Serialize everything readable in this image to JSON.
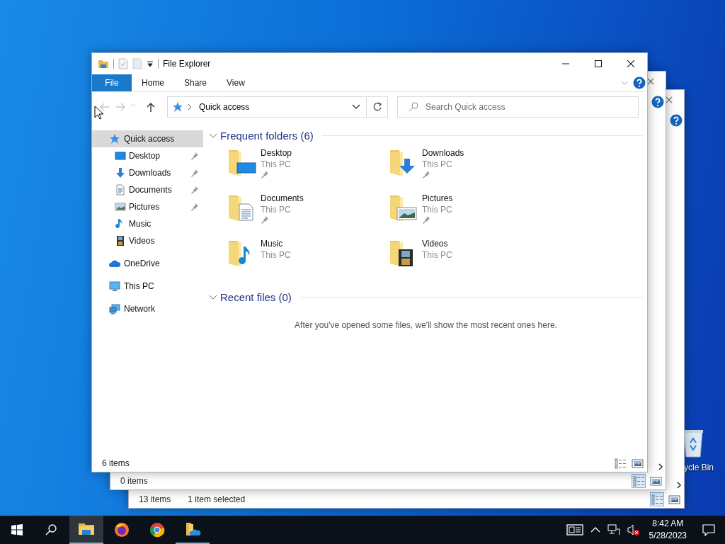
{
  "desktop": {
    "icons": [
      {
        "label": "ycle Bin",
        "kind": "recycle-bin"
      }
    ]
  },
  "background_windows": [
    {
      "status_items": [
        "13 items",
        "1 item selected"
      ],
      "view_buttons": [
        {
          "kind": "details",
          "selected": true
        },
        {
          "kind": "tiles",
          "selected": false
        }
      ]
    },
    {
      "status_items": [
        "0 items"
      ],
      "view_buttons": [
        {
          "kind": "details",
          "selected": true
        },
        {
          "kind": "tiles",
          "selected": false
        }
      ]
    }
  ],
  "window": {
    "title": "File Explorer",
    "ribbon_tabs": [
      {
        "label": "File",
        "kind": "menu"
      },
      {
        "label": "Home",
        "kind": "tab"
      },
      {
        "label": "Share",
        "kind": "tab"
      },
      {
        "label": "View",
        "kind": "tab"
      }
    ],
    "address": {
      "path": "Quick access"
    },
    "search": {
      "placeholder": "Search Quick access"
    },
    "sidebar": {
      "items": [
        {
          "label": "Quick access",
          "kind": "star",
          "selected": true,
          "children": [
            {
              "label": "Desktop",
              "kind": "desktop",
              "selected": false,
              "pinned": true
            },
            {
              "label": "Downloads",
              "kind": "downloads",
              "selected": false,
              "pinned": true
            },
            {
              "label": "Documents",
              "kind": "documents",
              "selected": false,
              "pinned": true
            },
            {
              "label": "Pictures",
              "kind": "pictures",
              "selected": false,
              "pinned": true
            },
            {
              "label": "Music",
              "kind": "music",
              "selected": false,
              "pinned": false
            },
            {
              "label": "Videos",
              "kind": "videos",
              "selected": false,
              "pinned": false
            }
          ]
        },
        {
          "label": "OneDrive",
          "kind": "onedrive",
          "selected": false
        },
        {
          "label": "This PC",
          "kind": "thispc",
          "selected": false
        },
        {
          "label": "Network",
          "kind": "network",
          "selected": false
        }
      ]
    },
    "sections": [
      {
        "title": "Frequent folders (6)",
        "expanded": true,
        "items": [
          {
            "name": "Desktop",
            "location": "This PC",
            "kind": "desktop",
            "pinned": true
          },
          {
            "name": "Downloads",
            "location": "This PC",
            "kind": "downloads",
            "pinned": true
          },
          {
            "name": "Documents",
            "location": "This PC",
            "kind": "documents",
            "pinned": true
          },
          {
            "name": "Pictures",
            "location": "This PC",
            "kind": "pictures",
            "pinned": true
          },
          {
            "name": "Music",
            "location": "This PC",
            "kind": "music",
            "pinned": false
          },
          {
            "name": "Videos",
            "location": "This PC",
            "kind": "videos",
            "pinned": false
          }
        ]
      },
      {
        "title": "Recent files (0)",
        "expanded": true,
        "message": "After you've opened some files, we'll show the most recent ones here."
      }
    ],
    "status_bar": {
      "text": "6 items",
      "view_buttons": [
        {
          "kind": "details",
          "selected": false
        },
        {
          "kind": "tiles",
          "selected": false
        }
      ]
    }
  },
  "taskbar": {
    "apps": [
      {
        "kind": "file-explorer",
        "active": true,
        "running": true
      },
      {
        "kind": "firefox",
        "active": false,
        "running": false
      },
      {
        "kind": "chrome",
        "active": false,
        "running": false
      },
      {
        "kind": "folder-cloud",
        "active": false,
        "running": true
      }
    ],
    "tray": {
      "time": "8:42 AM",
      "date": "5/28/2023"
    }
  }
}
